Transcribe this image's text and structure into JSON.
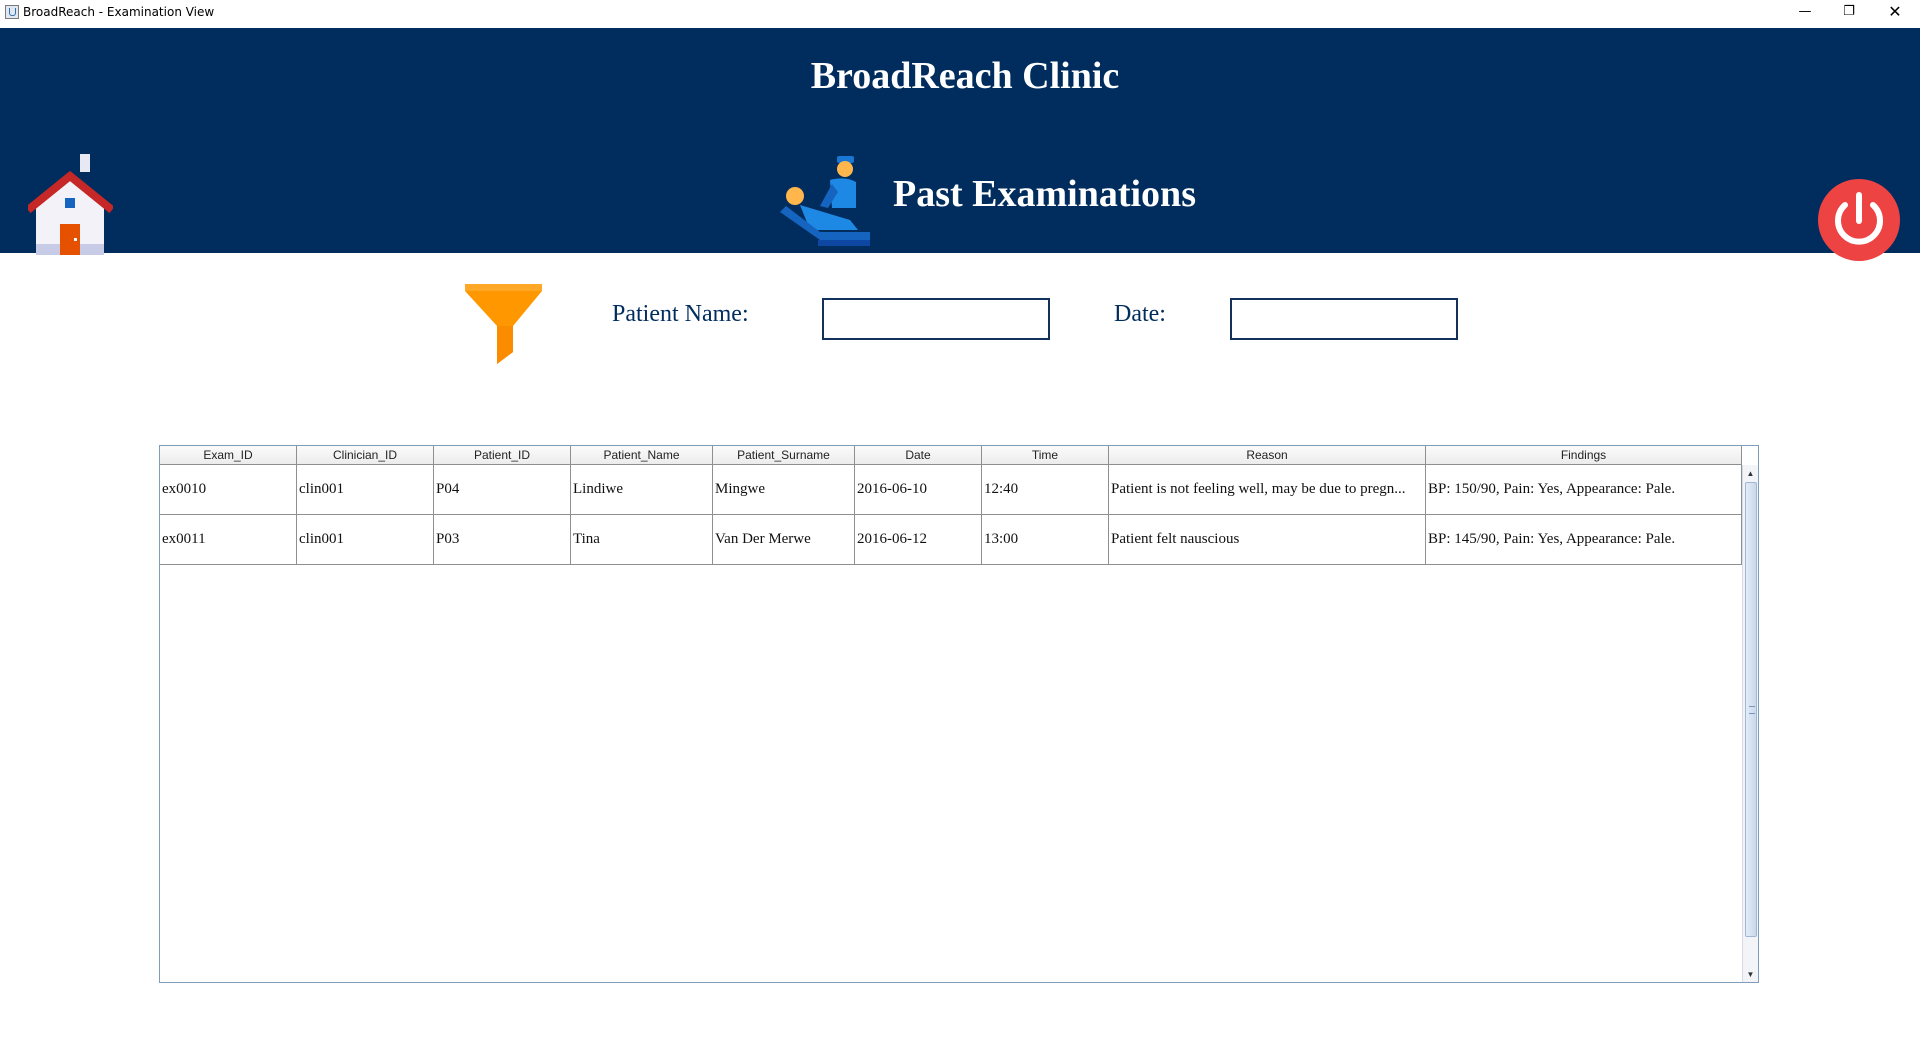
{
  "window": {
    "title": "BroadReach - Examination View",
    "minimize_glyph": "—",
    "restore_glyph": "❐",
    "close_glyph": "✕"
  },
  "header": {
    "clinic_title": "BroadReach Clinic",
    "page_title": "Past Examinations",
    "home_icon": "home-icon",
    "exam_icon": "doctor-examining-patient-icon",
    "power_icon": "power-icon",
    "colors": {
      "background": "#002d5d",
      "power": "#ee4343",
      "text": "#ffffff"
    }
  },
  "filter": {
    "icon": "funnel-filter-icon",
    "patient_name_label": "Patient Name:",
    "patient_name_value": "",
    "date_label": "Date:",
    "date_value": ""
  },
  "table": {
    "columns": [
      "Exam_ID",
      "Clinician_ID",
      "Patient_ID",
      "Patient_Name",
      "Patient_Surname",
      "Date",
      "Time",
      "Reason",
      "Findings"
    ],
    "rows": [
      [
        "ex0010",
        "clin001",
        "P04",
        "Lindiwe",
        "Mingwe",
        "2016-06-10",
        "12:40",
        "Patient is not feeling well, may be due to pregn...",
        "BP: 150/90, Pain: Yes, Appearance: Pale."
      ],
      [
        "ex0011",
        "clin001",
        "P03",
        "Tina",
        "Van Der Merwe",
        "2016-06-12",
        "13:00",
        "Patient felt nauscious",
        "BP: 145/90, Pain: Yes, Appearance: Pale."
      ]
    ],
    "scroll_up_glyph": "▲",
    "scroll_down_glyph": "▼"
  }
}
